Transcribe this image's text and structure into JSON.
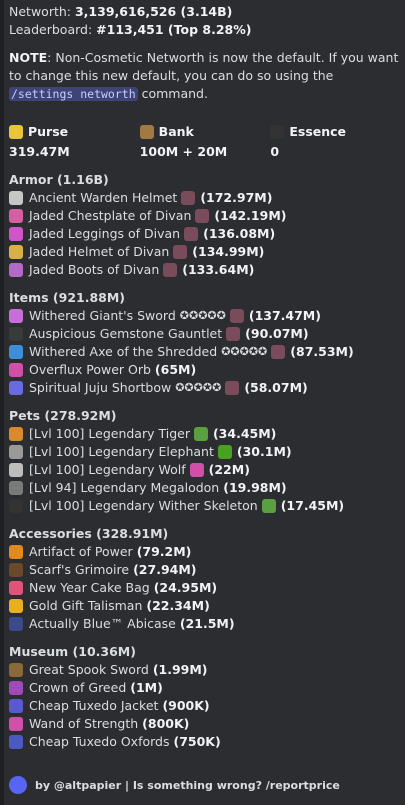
{
  "header": {
    "networth_label": "Networth:",
    "networth_value": "3,139,616,526 (3.14B)",
    "leaderboard_label": "Leaderboard:",
    "leaderboard_value": "#113,451 (Top 8.28%)"
  },
  "note": {
    "bold": "NOTE",
    "text1": ": Non-Cosmetic Networth is now the default. If you want to change this new default, you can do so using the ",
    "command": "/settings networth",
    "text2": " command."
  },
  "stats": [
    {
      "label": "Purse",
      "value": "319.47M",
      "icon": "gold-ingot-icon",
      "color": "#e8c53a"
    },
    {
      "label": "Bank",
      "value": "100M + 20M",
      "icon": "chest-icon",
      "color": "#a07a42"
    },
    {
      "label": "Essence",
      "value": "0",
      "icon": "coal-block-icon",
      "color": "#333333"
    }
  ],
  "sections": [
    {
      "title": "Armor (1.16B)",
      "items": [
        {
          "name": "Ancient Warden Helmet",
          "stars": "",
          "value": "(172.97M)",
          "icon": "helmet-icon",
          "color": "#c7c7c7",
          "extra": "gemstone-icon",
          "extra_color": "#7a4b5a"
        },
        {
          "name": "Jaded Chestplate of Divan",
          "stars": "",
          "value": "(142.19M)",
          "icon": "chestplate-icon",
          "color": "#d55fa3",
          "extra": "gemstone-icon",
          "extra_color": "#7a4b5a"
        },
        {
          "name": "Jaded Leggings of Divan",
          "stars": "",
          "value": "(136.08M)",
          "icon": "leggings-icon",
          "color": "#d055c8",
          "extra": "gemstone-icon",
          "extra_color": "#7a4b5a"
        },
        {
          "name": "Jaded Helmet of Divan",
          "stars": "",
          "value": "(134.99M)",
          "icon": "helmet-icon",
          "color": "#d8b046",
          "extra": "gemstone-icon",
          "extra_color": "#7a4b5a"
        },
        {
          "name": "Jaded Boots of Divan",
          "stars": "",
          "value": "(133.64M)",
          "icon": "boots-icon",
          "color": "#b46ac8",
          "extra": "gemstone-icon",
          "extra_color": "#7a4b5a"
        }
      ]
    },
    {
      "title": "Items (921.88M)",
      "items": [
        {
          "name": "Withered Giant's Sword",
          "stars": "✪✪✪✪✪",
          "value": "(137.47M)",
          "icon": "sword-icon",
          "color": "#c86ed8",
          "extra": "gemstone-icon",
          "extra_color": "#7a4b5a"
        },
        {
          "name": "Auspicious Gemstone Gauntlet",
          "stars": "",
          "value": "(90.07M)",
          "icon": "gauntlet-icon",
          "color": "#3a3a3a",
          "extra": "gemstone-icon",
          "extra_color": "#7a4b5a"
        },
        {
          "name": "Withered Axe of the Shredded",
          "stars": "✪✪✪✪✪",
          "value": "(87.53M)",
          "icon": "axe-icon",
          "color": "#3f8fd8",
          "extra": "gemstone-icon",
          "extra_color": "#7a4b5a"
        },
        {
          "name": "Overflux Power Orb",
          "stars": "",
          "value": "(65M)",
          "icon": "orb-icon",
          "color": "#d04fa8",
          "extra": "",
          "extra_color": ""
        },
        {
          "name": "Spiritual Juju Shortbow",
          "stars": "✪✪✪✪✪",
          "value": "(58.07M)",
          "icon": "bow-icon",
          "color": "#6a6ae0",
          "extra": "gemstone-icon",
          "extra_color": "#7a4b5a"
        }
      ]
    },
    {
      "title": "Pets (278.92M)",
      "items": [
        {
          "name": "[Lvl 100] Legendary Tiger",
          "stars": "",
          "value": "(34.45M)",
          "icon": "tiger-icon",
          "color": "#d88a2c",
          "extra": "pet-item-icon",
          "extra_color": "#5aa040"
        },
        {
          "name": "[Lvl 100] Legendary Elephant",
          "stars": "",
          "value": "(30.1M)",
          "icon": "elephant-icon",
          "color": "#9a9a9a",
          "extra": "pet-item-icon",
          "extra_color": "#4aa020"
        },
        {
          "name": "[Lvl 100] Legendary Wolf",
          "stars": "",
          "value": "(22M)",
          "icon": "wolf-icon",
          "color": "#bdbdbd",
          "extra": "pet-item-icon",
          "extra_color": "#d04fa8"
        },
        {
          "name": "[Lvl 94] Legendary Megalodon",
          "stars": "",
          "value": "(19.98M)",
          "icon": "megalodon-icon",
          "color": "#7a7a7a",
          "extra": "",
          "extra_color": ""
        },
        {
          "name": "[Lvl 100] Legendary Wither Skeleton",
          "stars": "",
          "value": "(17.45M)",
          "icon": "wither-skeleton-icon",
          "color": "#333333",
          "extra": "pet-item-icon",
          "extra_color": "#5aa040"
        }
      ]
    },
    {
      "title": "Accessories (328.91M)",
      "items": [
        {
          "name": "Artifact of Power",
          "stars": "",
          "value": "(79.2M)",
          "icon": "artifact-icon",
          "color": "#e08a20",
          "extra": "",
          "extra_color": ""
        },
        {
          "name": "Scarf's Grimoire",
          "stars": "",
          "value": "(27.94M)",
          "icon": "grimoire-icon",
          "color": "#6a4a2a",
          "extra": "",
          "extra_color": ""
        },
        {
          "name": "New Year Cake Bag",
          "stars": "",
          "value": "(24.95M)",
          "icon": "cake-bag-icon",
          "color": "#e0547a",
          "extra": "",
          "extra_color": ""
        },
        {
          "name": "Gold Gift Talisman",
          "stars": "",
          "value": "(22.34M)",
          "icon": "gift-icon",
          "color": "#e8b020",
          "extra": "",
          "extra_color": ""
        },
        {
          "name": "Actually Blue™ Abicase",
          "stars": "",
          "value": "(21.5M)",
          "icon": "abicase-icon",
          "color": "#3a4a8a",
          "extra": "",
          "extra_color": ""
        }
      ]
    },
    {
      "title": "Museum (10.36M)",
      "items": [
        {
          "name": "Great Spook Sword",
          "stars": "",
          "value": "(1.99M)",
          "icon": "sword-icon",
          "color": "#8a6a3a",
          "extra": "",
          "extra_color": ""
        },
        {
          "name": "Crown of Greed",
          "stars": "",
          "value": "(1M)",
          "icon": "crown-icon",
          "color": "#a04ab8",
          "extra": "",
          "extra_color": ""
        },
        {
          "name": "Cheap Tuxedo Jacket",
          "stars": "",
          "value": "(900K)",
          "icon": "jacket-icon",
          "color": "#5a5ad0",
          "extra": "",
          "extra_color": ""
        },
        {
          "name": "Wand of Strength",
          "stars": "",
          "value": "(800K)",
          "icon": "wand-icon",
          "color": "#d04fa8",
          "extra": "",
          "extra_color": ""
        },
        {
          "name": "Cheap Tuxedo Oxfords",
          "stars": "",
          "value": "(750K)",
          "icon": "boots-icon",
          "color": "#4a5ac0",
          "extra": "",
          "extra_color": ""
        }
      ]
    }
  ],
  "footer": {
    "text": "by @altpapier | Is something wrong? /reportprice",
    "avatar_color": "#5865f2"
  }
}
